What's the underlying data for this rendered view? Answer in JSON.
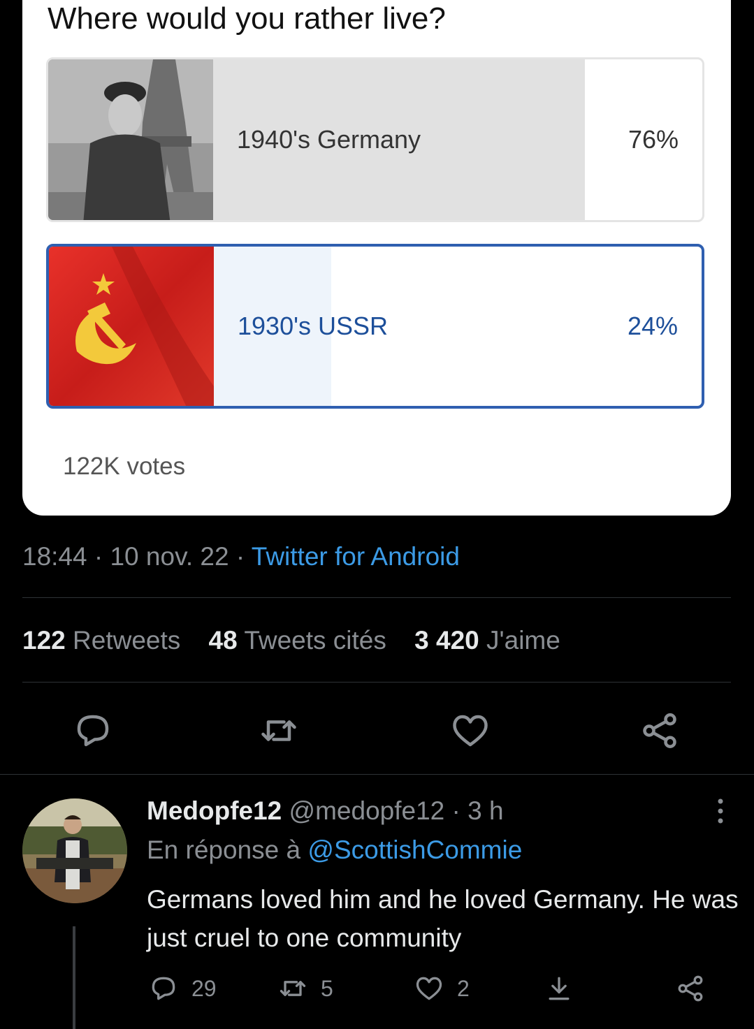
{
  "poll": {
    "question": "Where would you rather live?",
    "options": [
      {
        "label": "1940's Germany",
        "percent_text": "76%",
        "fraction": 0.76
      },
      {
        "label": "1930's USSR",
        "percent_text": "24%",
        "fraction": 0.24
      }
    ],
    "votes": "122K votes"
  },
  "tweet_meta": {
    "time": "18:44",
    "sep1": " · ",
    "date": "10 nov. 22",
    "sep2": " · ",
    "source": "Twitter for Android"
  },
  "stats": {
    "retweets_count": "122",
    "retweets_label": "Retweets",
    "quotes_count": "48",
    "quotes_label": "Tweets cités",
    "likes_count": "3 420",
    "likes_label": "J'aime"
  },
  "actions": [
    "reply-icon",
    "retweet-icon",
    "like-icon",
    "share-icon"
  ],
  "reply": {
    "display_name": "Medopfe12",
    "handle": "@medopfe12",
    "sep": " · ",
    "time": "3 h",
    "reply_prefix": "En réponse à",
    "reply_handle": "@ScottishCommie",
    "text": "Germans loved him and he loved Germany. He was just cruel to one community",
    "counts": {
      "replies": "29",
      "retweets": "5",
      "likes": "2"
    }
  },
  "colors": {
    "background": "#000000",
    "accent_blue": "#3c9be6",
    "selected_option_border": "#2f5fb0",
    "muted_text": "#8b8f94"
  }
}
